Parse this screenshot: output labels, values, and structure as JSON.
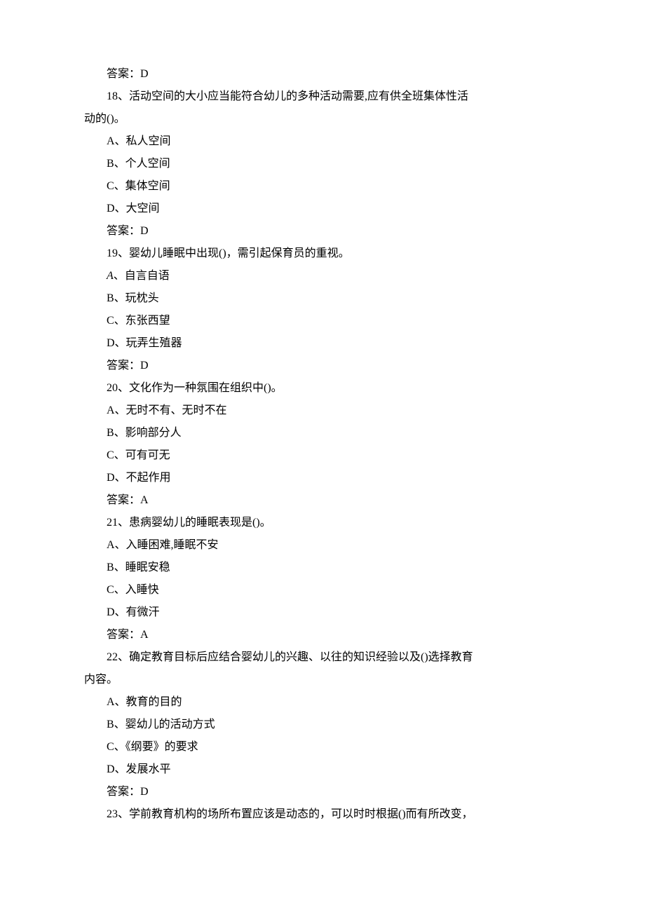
{
  "lines": [
    "答案：D",
    "18、活动空间的大小应当能符合幼儿的多种活动需要,应有供全班集体性活",
    "__NOINDENT__动的()。",
    "A、私人空间",
    "B、个人空间",
    "C、集体空间",
    "D、大空间",
    "答案：D",
    "19、婴幼儿睡眠中出现()，需引起保育员的重视。",
    "__ITALIC_A__、自言自语",
    "B、玩枕头",
    "C、东张西望",
    "D、玩弄生殖器",
    "答案：D",
    "20、文化作为一种氛围在组织中()。",
    "A、无时不有、无时不在",
    "B、影响部分人",
    "C、可有可无",
    "D、不起作用",
    "答案：A",
    "21、患病婴幼儿的睡眠表现是()。",
    "A、入睡困难,睡眠不安",
    "B、睡眠安稳",
    "C、入睡快",
    "D、有微汗",
    "答案：A",
    "22、确定教育目标后应结合婴幼儿的兴趣、以往的知识经验以及()选择教育",
    "__NOINDENT__内容。",
    "A、教育的目的",
    "B、婴幼儿的活动方式",
    "C、《纲要》的要求",
    "D、发展水平",
    "答案：D",
    "23、学前教育机构的场所布置应该是动态的，可以时时根据()而有所改变，"
  ]
}
